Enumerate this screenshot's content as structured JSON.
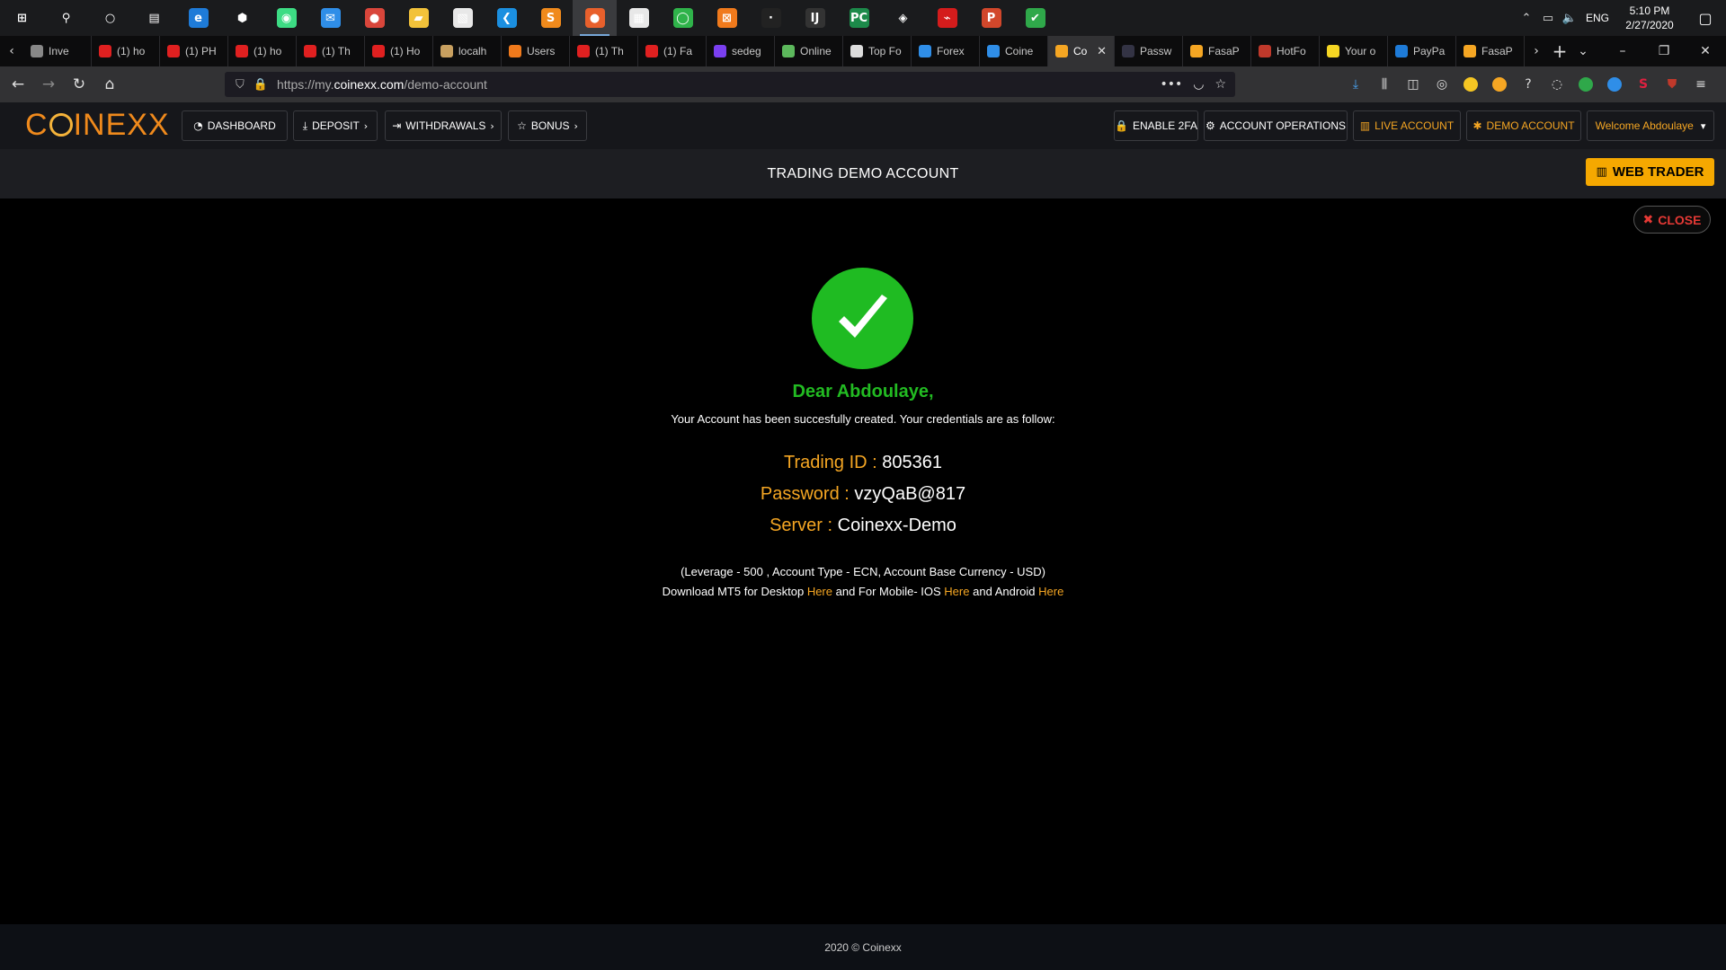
{
  "taskbar": {
    "apps": [
      {
        "name": "start-icon",
        "glyph": "⊞",
        "color": "transparent",
        "open": false
      },
      {
        "name": "search-icon",
        "glyph": "⚲",
        "color": "transparent",
        "open": false
      },
      {
        "name": "cortana-icon",
        "glyph": "○",
        "color": "transparent",
        "open": false
      },
      {
        "name": "task-view-icon",
        "glyph": "▤",
        "color": "transparent",
        "open": false
      },
      {
        "name": "edge-icon",
        "glyph": "e",
        "color": "#1e7bd8",
        "open": false
      },
      {
        "name": "hexagon-app-icon",
        "glyph": "⬢",
        "color": "transparent",
        "open": false
      },
      {
        "name": "android-studio-icon",
        "glyph": "◉",
        "color": "#3ddc84",
        "open": false
      },
      {
        "name": "mail-icon",
        "glyph": "✉",
        "color": "#2f8ee8",
        "open": false
      },
      {
        "name": "chrome-icon",
        "glyph": "●",
        "color": "#d9463b",
        "open": false
      },
      {
        "name": "file-explorer-icon",
        "glyph": "▰",
        "color": "#f2c23a",
        "open": false
      },
      {
        "name": "document-app-icon",
        "glyph": "▧",
        "color": "#e8e8e8",
        "open": false
      },
      {
        "name": "vscode-icon",
        "glyph": "❮",
        "color": "#1b8fe0",
        "open": false
      },
      {
        "name": "sublime-icon",
        "glyph": "S",
        "color": "#f08a1c",
        "open": false
      },
      {
        "name": "firefox-icon",
        "glyph": "●",
        "color": "#e8602c",
        "open": true
      },
      {
        "name": "store-icon",
        "glyph": "▦",
        "color": "#e8e8e8",
        "open": false
      },
      {
        "name": "circle-app-icon",
        "glyph": "◯",
        "color": "#2fb34a",
        "open": false
      },
      {
        "name": "xampp-icon",
        "glyph": "⊠",
        "color": "#f07a1c",
        "open": false
      },
      {
        "name": "terminal-icon",
        "glyph": "·",
        "color": "#222",
        "open": false
      },
      {
        "name": "intellij-icon",
        "glyph": "IJ",
        "color": "#333",
        "open": false
      },
      {
        "name": "pycharm-icon",
        "glyph": "PC",
        "color": "#1c8a4a",
        "open": false
      },
      {
        "name": "virtualbox-icon",
        "glyph": "◈",
        "color": "transparent",
        "open": false
      },
      {
        "name": "acrobat-icon",
        "glyph": "⌁",
        "color": "#d41c1c",
        "open": false
      },
      {
        "name": "powerpoint-icon",
        "glyph": "P",
        "color": "#d2472b",
        "open": false
      },
      {
        "name": "checkmark-app-icon",
        "glyph": "✔",
        "color": "#2fa84a",
        "open": false
      }
    ],
    "language": "ENG",
    "time": "5:10 PM",
    "date": "2/27/2020"
  },
  "tabs": [
    {
      "label": "Inve",
      "fav": "#888888"
    },
    {
      "label": "(1) ho",
      "fav": "#e02020"
    },
    {
      "label": "(1) PH",
      "fav": "#e02020"
    },
    {
      "label": "(1) ho",
      "fav": "#e02020"
    },
    {
      "label": "(1) Th",
      "fav": "#e02020"
    },
    {
      "label": "(1) Ho",
      "fav": "#e02020"
    },
    {
      "label": "localh",
      "fav": "#c8a060"
    },
    {
      "label": "Users",
      "fav": "#f07a1c"
    },
    {
      "label": "(1) Th",
      "fav": "#e02020"
    },
    {
      "label": "(1) Fa",
      "fav": "#e02020"
    },
    {
      "label": "sedeg",
      "fav": "#7a3ff0"
    },
    {
      "label": "Online",
      "fav": "#5cb85c"
    },
    {
      "label": "Top Fo",
      "fav": "#ddd"
    },
    {
      "label": "Forex",
      "fav": "#2f8ee8"
    },
    {
      "label": "Coine",
      "fav": "#2f8ee8"
    },
    {
      "label": "Co",
      "fav": "#f5a623",
      "active": true
    },
    {
      "label": "Passw",
      "fav": "#334"
    },
    {
      "label": "FasaP",
      "fav": "#f5a623"
    },
    {
      "label": "HotFo",
      "fav": "#c0392b"
    },
    {
      "label": "Your o",
      "fav": "#f5d623"
    },
    {
      "label": "PayPa",
      "fav": "#1e7bd8"
    },
    {
      "label": "FasaP",
      "fav": "#f5a623"
    }
  ],
  "url": {
    "prefix": "https://my.",
    "host": "coinexx.com",
    "path": "/demo-account"
  },
  "header": {
    "logo": "COINEXX",
    "nav_left": [
      {
        "label": "DASHBOARD",
        "icon": "gauge-icon",
        "glyph": "◔",
        "chevron": false
      },
      {
        "label": "DEPOSIT",
        "icon": "download-icon",
        "glyph": "⤓",
        "chevron": true
      },
      {
        "label": "WITHDRAWALS",
        "icon": "sign-out-icon",
        "glyph": "⇥",
        "chevron": true
      },
      {
        "label": "BONUS",
        "icon": "star-icon",
        "glyph": "☆",
        "chevron": true
      }
    ],
    "nav_right": [
      {
        "label": "ENABLE 2FA",
        "icon": "lock-icon",
        "glyph": "🔒"
      },
      {
        "label": "ACCOUNT OPERATIONS",
        "icon": "cogs-icon",
        "glyph": "⚙"
      },
      {
        "label": "LIVE ACCOUNT",
        "icon": "bar-chart-icon",
        "glyph": "▥"
      },
      {
        "label": "DEMO ACCOUNT",
        "icon": "asterisk-icon",
        "glyph": "✱"
      }
    ],
    "welcome": "Welcome Abdoulaye"
  },
  "title_bar": {
    "title": "TRADING DEMO ACCOUNT",
    "web_trader": "WEB TRADER"
  },
  "main": {
    "close": "CLOSE",
    "greeting": "Dear Abdoulaye,",
    "message": "Your Account has been succesfully created. Your credentials are as follow:",
    "credentials": [
      {
        "key": "Trading ID :",
        "value": "805361"
      },
      {
        "key": "Password :",
        "value": "vzyQaB@817"
      },
      {
        "key": "Server :",
        "value": "Coinexx-Demo"
      }
    ],
    "note": "(Leverage - 500 , Account Type - ECN, Account Base Currency - USD)",
    "download": {
      "part1": "Download MT5 for Desktop",
      "link1": "Here",
      "part2": "and For Mobile- IOS",
      "link2": "Here",
      "part3": "and Android",
      "link3": "Here"
    }
  },
  "footer": {
    "copyright": "2020 © Coinexx"
  },
  "colors": {
    "accent": "#f5a623",
    "success": "#22bb22",
    "danger": "#e53935"
  }
}
